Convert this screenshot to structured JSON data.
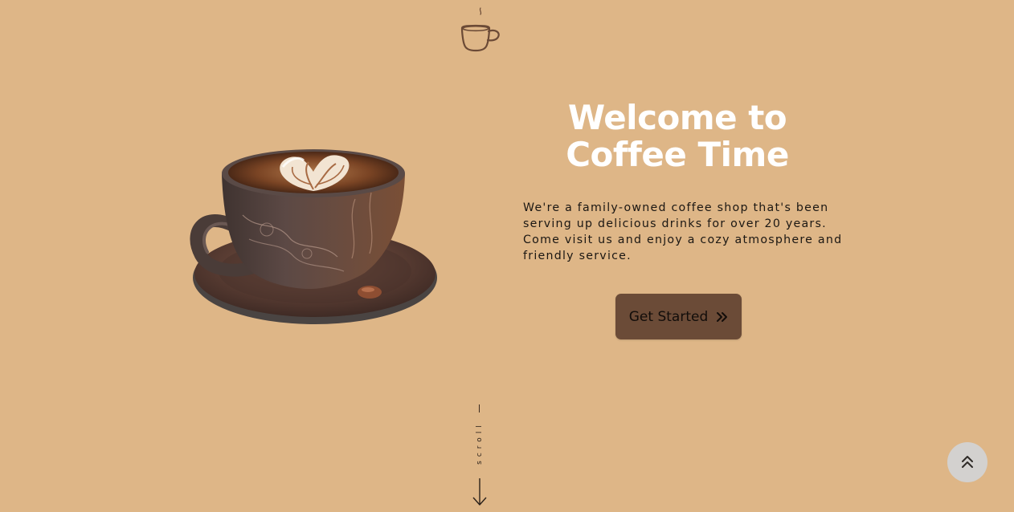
{
  "logo": {
    "icon": "coffee-cup-icon"
  },
  "hero": {
    "image_icon": "latte-cup-image",
    "title": "Welcome to Coffee Time",
    "description": "We're a family-owned coffee shop that's been serving up delicious drinks for over 20 years. Come visit us and enjoy a cozy atmosphere and friendly service.",
    "cta_label": "Get Started",
    "cta_icon": "double-chevron-right-icon"
  },
  "scroll": {
    "label": "scroll",
    "icon": "arrow-down-icon"
  },
  "back_to_top": {
    "icon": "double-chevron-up-icon"
  },
  "colors": {
    "background": "#DEB687",
    "button": "#6B4B37",
    "title": "#FFFFFF",
    "back_to_top": "#D3D1CF"
  }
}
